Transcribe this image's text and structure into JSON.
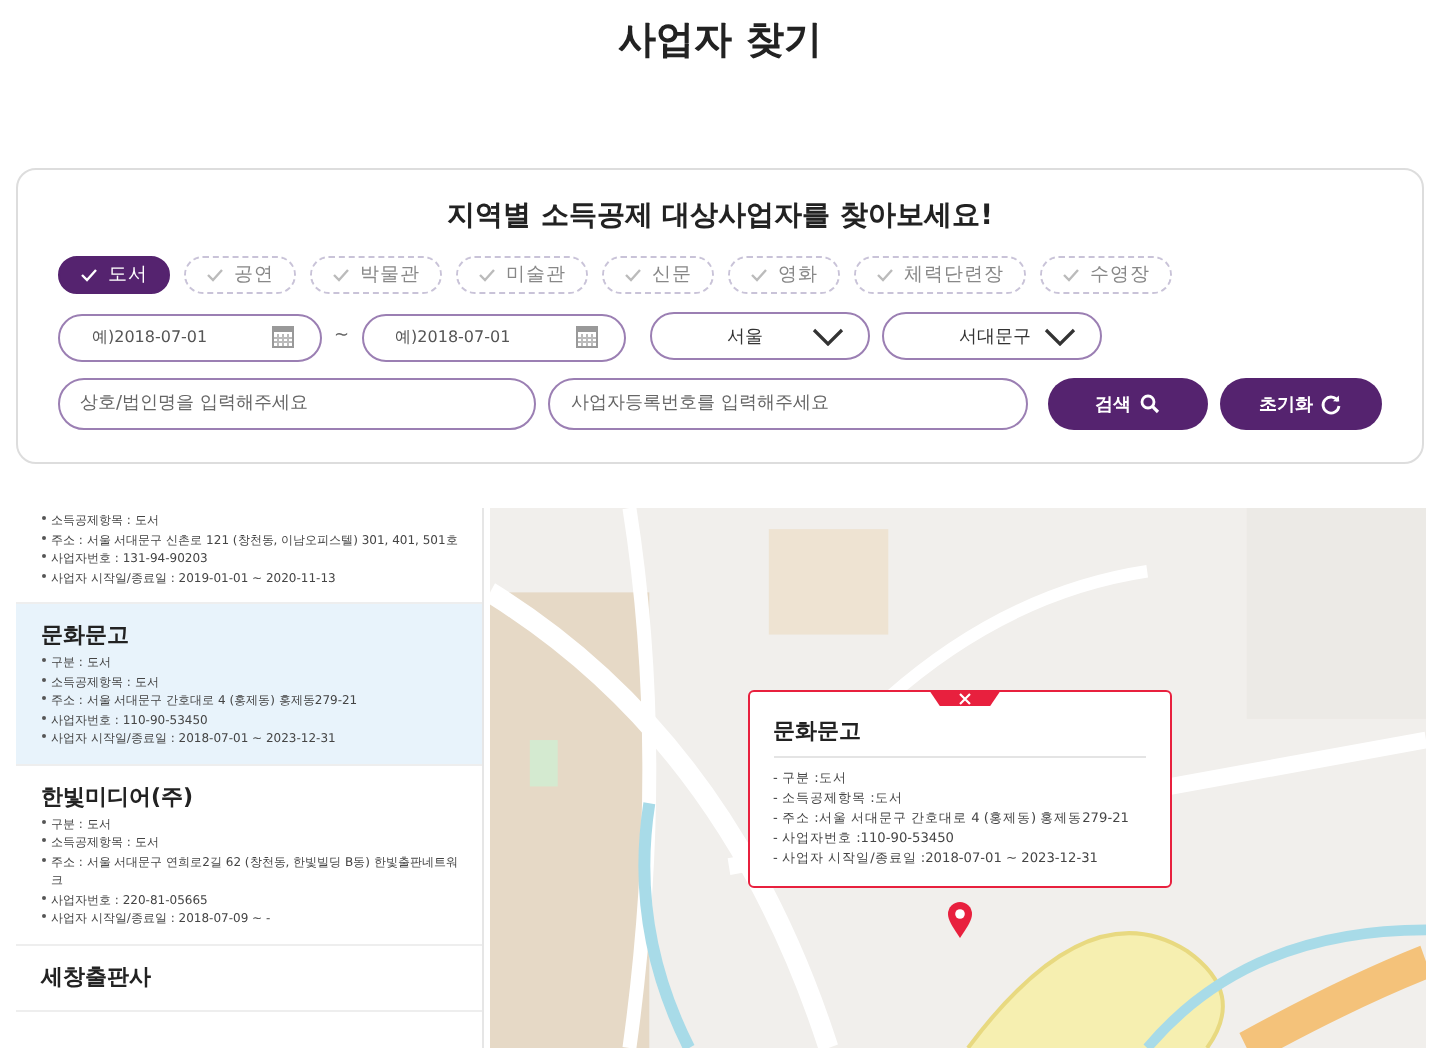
{
  "page_title": "사업자 찾기",
  "search": {
    "heading": "지역별 소득공제 대상사업자를 찾아보세요!",
    "categories": [
      {
        "label": "도서",
        "selected": true
      },
      {
        "label": "공연",
        "selected": false
      },
      {
        "label": "박물관",
        "selected": false
      },
      {
        "label": "미술관",
        "selected": false
      },
      {
        "label": "신문",
        "selected": false
      },
      {
        "label": "영화",
        "selected": false
      },
      {
        "label": "체력단련장",
        "selected": false
      },
      {
        "label": "수영장",
        "selected": false
      }
    ],
    "start_date": {
      "placeholder": "예)2018-07-01"
    },
    "date_separator": "~",
    "end_date": {
      "placeholder": "예)2018-07-01"
    },
    "region": "서울",
    "district": "서대문구",
    "name_field": {
      "placeholder": "상호/법인명을 입력해주세요"
    },
    "number_field": {
      "placeholder": "사업자등록번호를 입력해주세요"
    },
    "search_button": "검색",
    "reset_button": "초기화"
  },
  "results": [
    {
      "selected": false,
      "lines": [
        "소득공제항목 : 도서",
        "주소 : 서울 서대문구 신촌로 121 (창천동, 이남오피스텔) 301, 401, 501호",
        "사업자번호 : 131-94-90203",
        "사업자 시작일/종료일 : 2019-01-01 ~ 2020-11-13"
      ]
    },
    {
      "name": "문화문고",
      "selected": true,
      "lines": [
        "구분 : 도서",
        "소득공제항목 : 도서",
        "주소 : 서울 서대문구 간호대로 4 (홍제동) 홍제동279-21",
        "사업자번호 : 110-90-53450",
        "사업자 시작일/종료일 : 2018-07-01 ~ 2023-12-31"
      ]
    },
    {
      "name": "한빛미디어(주)",
      "selected": false,
      "lines": [
        "구분 : 도서",
        "소득공제항목 : 도서",
        "주소 : 서울 서대문구 연희로2길 62 (창천동, 한빛빌딩 B동) 한빛출판네트워크",
        "사업자번호 : 220-81-05665",
        "사업자 시작일/종료일 : 2018-07-09 ~ -"
      ]
    },
    {
      "name": "세창출판사",
      "selected": false
    }
  ],
  "map_popup": {
    "title": "문화문고",
    "lines": [
      "- 구분 :도서",
      "- 소득공제항목 :도서",
      "- 주소 :서울 서대문구 간호대로 4 (홍제동) 홍제동279-21",
      "- 사업자번호 :110-90-53450",
      "- 사업자 시작일/종료일 :2018-07-01 ~ 2023-12-31"
    ]
  }
}
